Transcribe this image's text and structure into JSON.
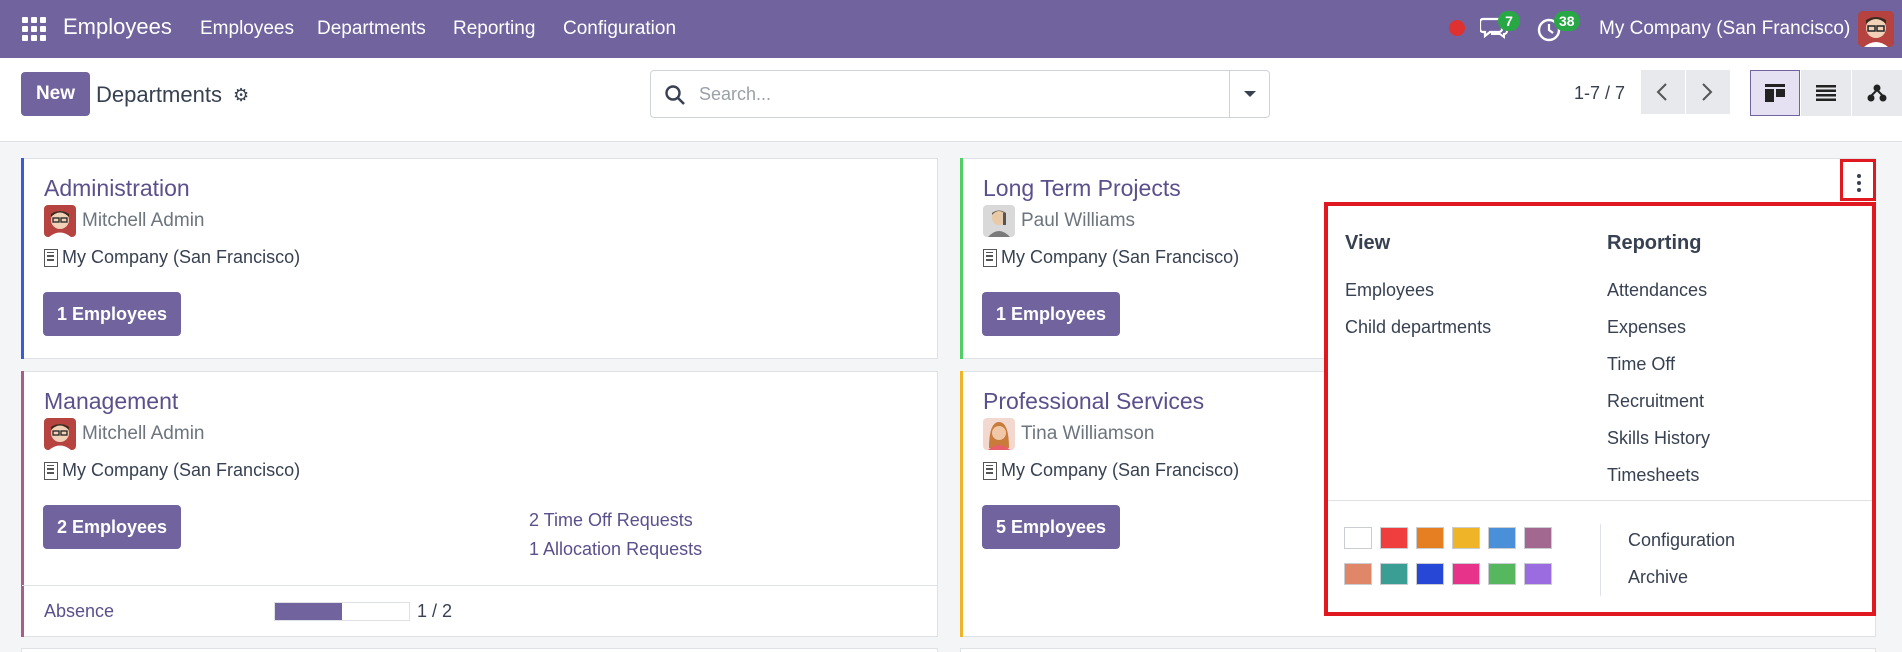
{
  "navbar": {
    "app_name": "Employees",
    "menu": [
      "Employees",
      "Departments",
      "Reporting",
      "Configuration"
    ],
    "chat_count": "7",
    "activity_count": "38",
    "company": "My Company (San Francisco)"
  },
  "control": {
    "new_label": "New",
    "title": "Departments",
    "search_placeholder": "Search...",
    "pager": "1-7 / 7"
  },
  "cards": [
    {
      "title": "Administration",
      "manager": "Mitchell Admin",
      "company": "My Company (San Francisco)",
      "employees": "1 Employees",
      "accent": "#3b5bdb"
    },
    {
      "title": "Long Term Projects",
      "manager": "Paul Williams",
      "company": "My Company (San Francisco)",
      "employees": "1 Employees",
      "accent": "#51cf66"
    },
    {
      "title": "Management",
      "manager": "Mitchell Admin",
      "company": "My Company (San Francisco)",
      "employees": "2 Employees",
      "accent": "#a85d8a",
      "time_off_requests": "2 Time Off Requests",
      "allocation_requests": "1 Allocation Requests",
      "absence_label": "Absence",
      "absence_value": "1 / 2",
      "absence_fraction": 0.5
    },
    {
      "title": "Professional Services",
      "manager": "Tina Williamson",
      "company": "My Company (San Francisco)",
      "employees": "5 Employees",
      "accent": "#f0b429"
    }
  ],
  "dropdown": {
    "view_heading": "View",
    "view_items": [
      "Employees",
      "Child departments"
    ],
    "reporting_heading": "Reporting",
    "reporting_items": [
      "Attendances",
      "Expenses",
      "Time Off",
      "Recruitment",
      "Skills History",
      "Timesheets"
    ],
    "actions": [
      "Configuration",
      "Archive"
    ],
    "colors": [
      "#ffffff",
      "#f03e3e",
      "#e67e22",
      "#f0b429",
      "#4a90d9",
      "#a3688f",
      "#e0876a",
      "#3a9e94",
      "#2747d6",
      "#e8338a",
      "#55b85f",
      "#9b6be0"
    ]
  }
}
